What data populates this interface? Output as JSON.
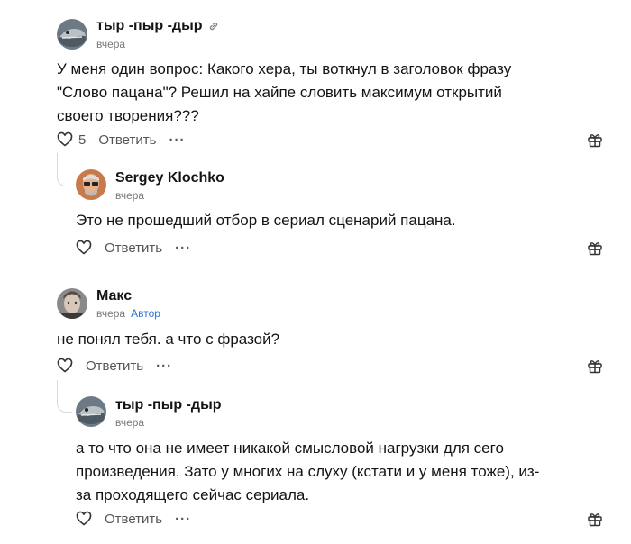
{
  "comments": [
    {
      "author": "тыр -пыр -дыр",
      "time": "вчера",
      "text_lines": [
        "У меня один вопрос: Какого хера, ты воткнул в заголовок фразу",
        "\"Слово пацана\"? Решил на хайпе словить максимум открытий",
        "своего творения???"
      ],
      "likes": "5",
      "reply_label": "Ответить",
      "more_label": "···"
    },
    {
      "author": "Sergey Klochko",
      "time": "вчера",
      "text_lines": [
        "Это не прошедший отбор в сериал сценарий пацана."
      ],
      "reply_label": "Ответить",
      "more_label": "···"
    },
    {
      "author": "Макс",
      "time": "вчера",
      "badge": "Автор",
      "text_lines": [
        "не понял тебя. а что с фразой?"
      ],
      "reply_label": "Ответить",
      "more_label": "···"
    },
    {
      "author": "тыр -пыр -дыр",
      "time": "вчера",
      "text_lines": [
        "а то что она не имеет никакой смысловой нагрузки для сего",
        "произведения. Зато у многих на слуху (кстати и у меня тоже), из-",
        "за проходящего сейчас сериала."
      ],
      "reply_label": "Ответить",
      "more_label": "···"
    }
  ],
  "colors": {
    "text": "#141414",
    "meta": "#7a7a7a",
    "badge": "#2f73d8",
    "action": "#555555",
    "thread_line": "#d9d9d9"
  },
  "icons": [
    "heart-icon",
    "gift-icon",
    "link-icon",
    "more-icon"
  ]
}
